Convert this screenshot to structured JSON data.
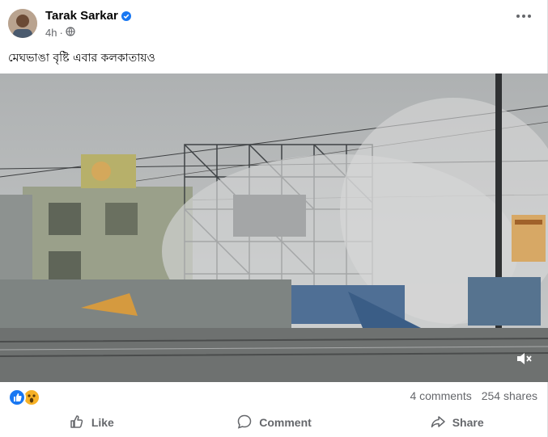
{
  "post": {
    "author": "Tarak Sarkar",
    "time": "4h",
    "text": "মেঘভাঙা বৃষ্টি এবার কলকাতায়ও"
  },
  "stats": {
    "comments": "4 comments",
    "shares": "254 shares"
  },
  "actions": {
    "like": "Like",
    "comment": "Comment",
    "share": "Share"
  },
  "icons": [
    "verified-badge-icon",
    "globe-icon",
    "more-options-icon",
    "volume-muted-icon",
    "like-reaction-icon",
    "wow-reaction-icon",
    "like-icon",
    "comment-icon",
    "share-icon"
  ],
  "colors": {
    "accent": "#1877f2",
    "secondary_text": "#65676b"
  }
}
